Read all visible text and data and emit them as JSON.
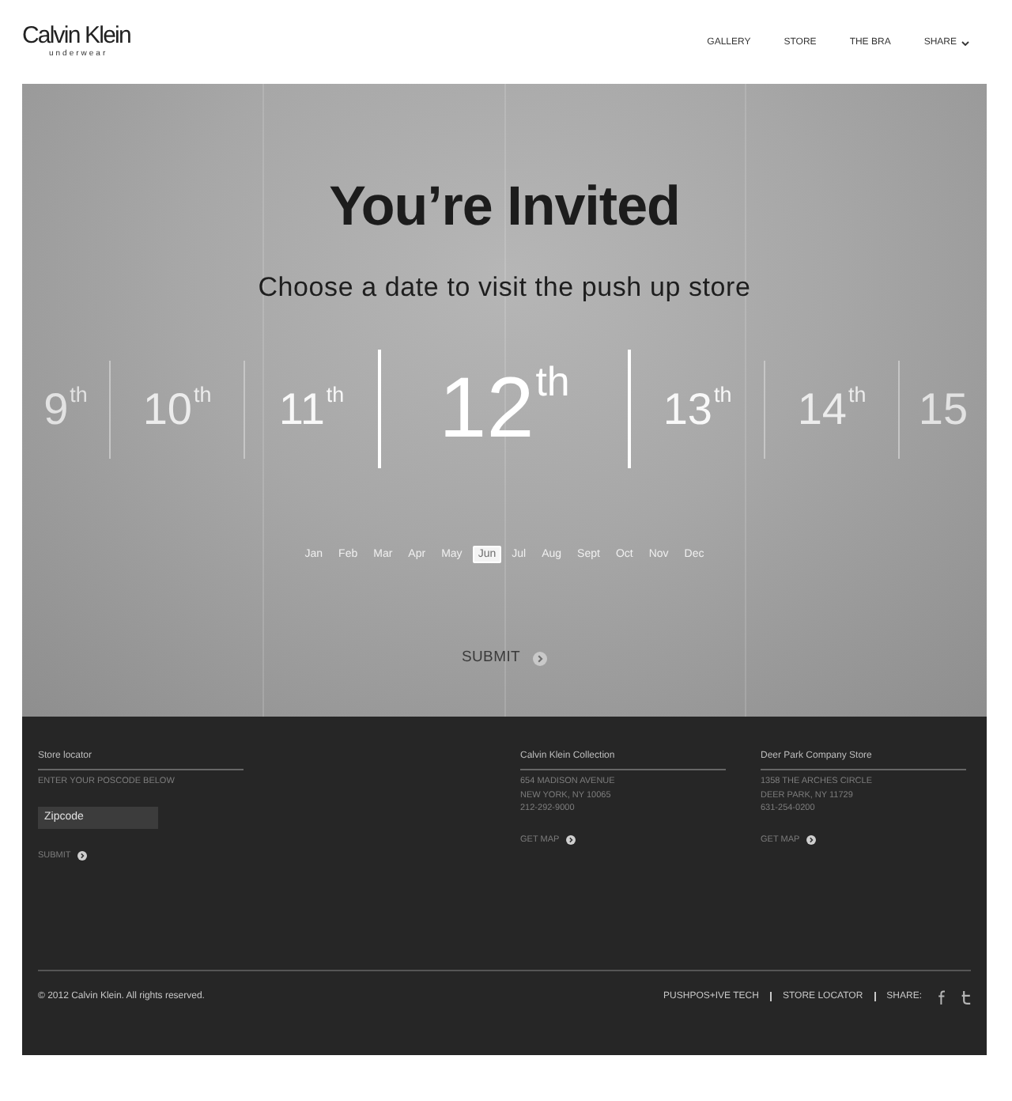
{
  "header": {
    "logo": {
      "wordmark": "Calvin Klein",
      "tagline": "underwear"
    },
    "nav": [
      {
        "label": "GALLERY",
        "kind": "link"
      },
      {
        "label": "STORE",
        "kind": "link"
      },
      {
        "label": "THE BRA",
        "kind": "link"
      },
      {
        "label": "SHARE",
        "kind": "dropdown"
      }
    ]
  },
  "hero": {
    "title": "You’re Invited",
    "subtitle": "Choose a date to visit the push up store",
    "dates": [
      {
        "day": "9",
        "suffix": "th",
        "selected": false
      },
      {
        "day": "10",
        "suffix": "th",
        "selected": false
      },
      {
        "day": "11",
        "suffix": "th",
        "selected": false
      },
      {
        "day": "12",
        "suffix": "th",
        "selected": true
      },
      {
        "day": "13",
        "suffix": "th",
        "selected": false
      },
      {
        "day": "14",
        "suffix": "th",
        "selected": false
      },
      {
        "day": "15",
        "selected": false
      }
    ],
    "months": [
      {
        "label": "Jan",
        "selected": false
      },
      {
        "label": "Feb",
        "selected": false
      },
      {
        "label": "Mar",
        "selected": false
      },
      {
        "label": "Apr",
        "selected": false
      },
      {
        "label": "May",
        "selected": false
      },
      {
        "label": "Jun",
        "selected": true
      },
      {
        "label": "Jul",
        "selected": false
      },
      {
        "label": "Aug",
        "selected": false
      },
      {
        "label": "Sept",
        "selected": false
      },
      {
        "label": "Oct",
        "selected": false
      },
      {
        "label": "Nov",
        "selected": false
      },
      {
        "label": "Dec",
        "selected": false
      }
    ],
    "submit": "SUBMIT"
  },
  "footer": {
    "store_locator": {
      "heading": "Store locator",
      "instruction": "ENTER YOUR POSCODE BELOW",
      "zipcode": {
        "placeholder": "Zipcode"
      },
      "submit": "SUBMIT"
    },
    "stores": [
      {
        "name": "Calvin Klein Collection",
        "address": [
          "654 MADISON AVENUE",
          "NEW YORK, NY 10065",
          "212-292-9000"
        ],
        "link": "GET MAP"
      },
      {
        "name": "Deer Park Company Store",
        "address": [
          "1358 THE ARCHES CIRCLE",
          "DEER PARK, NY 11729",
          "631-254-0200"
        ],
        "link": "GET MAP"
      }
    ],
    "copyright": "© 2012 Calvin Klein. All rights reserved.",
    "links": [
      "PUSHPOS+IVE TECH",
      "STORE LOCATOR"
    ],
    "share": {
      "label": "SHARE:"
    }
  }
}
